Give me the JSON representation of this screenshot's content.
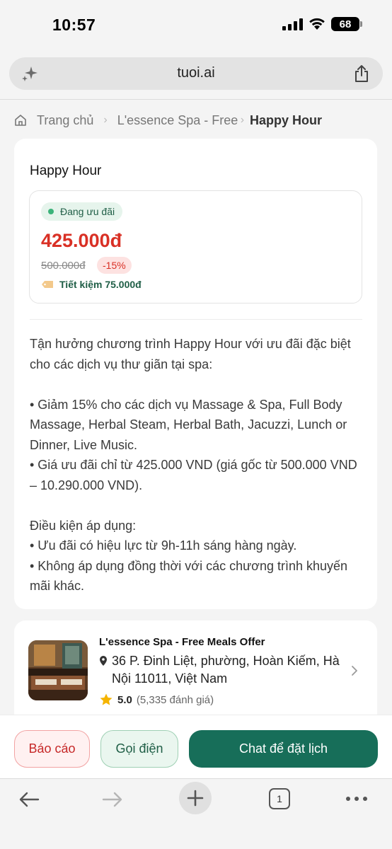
{
  "status": {
    "time": "10:57",
    "battery": "68"
  },
  "browser": {
    "url": "tuoi.ai",
    "tab_count": "1"
  },
  "breadcrumb": {
    "home": "Trang chủ",
    "spa": "L'essence Spa - Free Meals Offer",
    "current": "Happy Hour"
  },
  "offer": {
    "title": "Happy Hour",
    "status_badge": "Đang ưu đãi",
    "price": "425.000đ",
    "old_price": "500.000đ",
    "discount": "-15%",
    "savings": "Tiết kiệm 75.000đ",
    "description": [
      "Tận hưởng chương trình Happy Hour với ưu đãi đặc biệt cho các dịch vụ thư giãn tại spa:",
      "",
      "• Giảm 15% cho các dịch vụ Massage & Spa, Full Body Massage, Herbal Steam, Herbal Bath, Jacuzzi, Lunch or Dinner, Live Music.",
      "• Giá ưu đãi chỉ từ 425.000 VND (giá gốc từ 500.000 VND – 10.290.000 VND).",
      "",
      "Điều kiện áp dụng:",
      "• Ưu đãi có hiệu lực từ 9h-11h sáng hàng ngày.",
      "• Không áp dụng đồng thời với các chương trình khuyến mãi khác."
    ]
  },
  "venue": {
    "name": "L'essence Spa - Free Meals Offer",
    "address": "36 P. Đinh Liệt, phường, Hoàn Kiếm, Hà Nội 11011, Việt Nam",
    "rating": "5.0",
    "review_count": "(5,335 đánh giá)"
  },
  "actions": {
    "report": "Báo cáo",
    "call": "Gọi điện",
    "chat": "Chat để đặt lịch"
  },
  "colors": {
    "accent_green": "#176e59",
    "price_red": "#d93025",
    "page_bg": "#f4f4f4"
  },
  "icons": [
    "sparkle-icon",
    "share-icon",
    "home-icon",
    "tag-icon",
    "pin-icon",
    "star-icon",
    "chevron-right-icon",
    "back-arrow-icon",
    "forward-arrow-icon",
    "new-tab-icon",
    "tabs-icon",
    "more-icon"
  ]
}
